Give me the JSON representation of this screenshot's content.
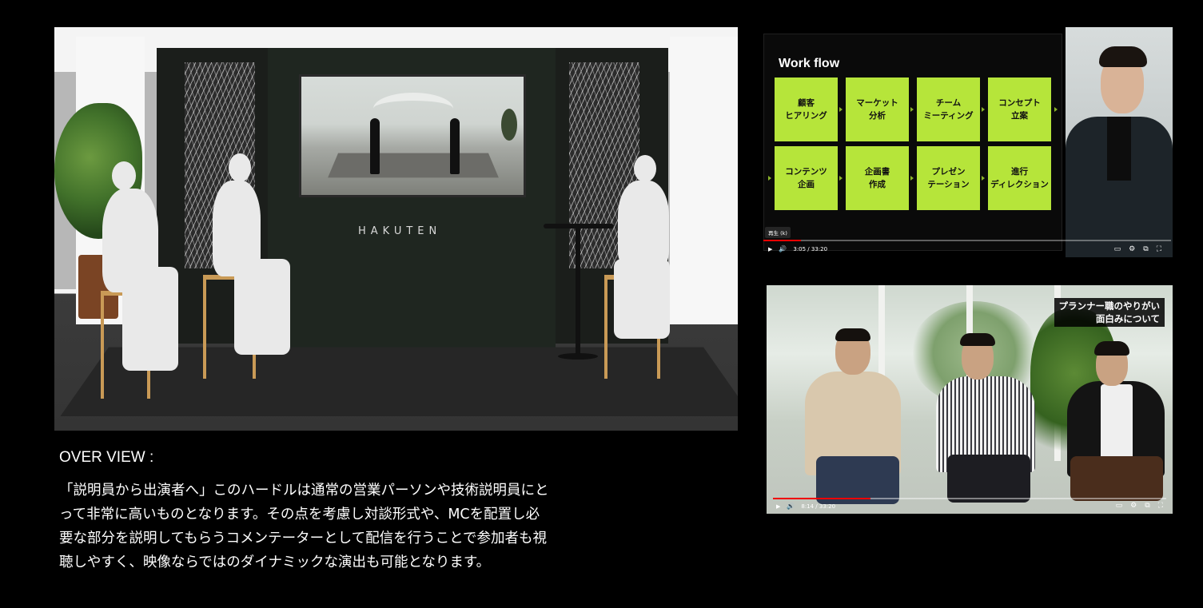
{
  "main_render": {
    "logo_text": "HAKUTEN"
  },
  "overview": {
    "title": "OVER VIEW :",
    "lines": [
      "「説明員から出演者へ」このハードルは通常の営業パーソンや技術説明員にと",
      "って非常に高いものとなります。その点を考慮し対談形式や、MCを配置し必",
      "要な部分を説明してもらうコメンテーターとして配信を行うことで参加者も視",
      "聴しやすく、映像ならではのダイナミックな演出も可能となります。"
    ]
  },
  "video1": {
    "slide_title": "Work flow",
    "steps": [
      "顧客\nヒアリング",
      "マーケット\n分析",
      "チーム\nミーティング",
      "コンセプト\n立案",
      "コンテンツ\n企画",
      "企画書\n作成",
      "プレゼン\nテーション",
      "進行\nディレクション"
    ],
    "tooltip": "再生 (k)",
    "time": "3:05 / 33:20",
    "progress_fraction": 0.0925,
    "accent_color": "#b6e53a"
  },
  "video2": {
    "caption_lines": [
      "プランナー職のやりがい",
      "面白みについて"
    ],
    "time": "8:14 / 33:20",
    "progress_fraction": 0.247
  },
  "icons": {
    "play": "▶",
    "volume": "🔊",
    "subtitles": "▭",
    "settings": "⚙",
    "miniplayer": "⧉",
    "fullscreen": "⛶"
  }
}
